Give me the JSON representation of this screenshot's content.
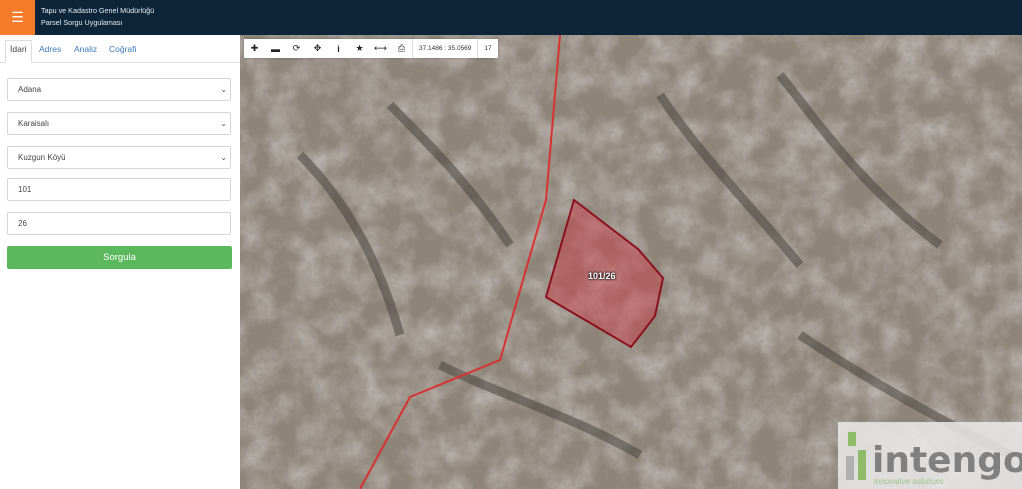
{
  "header": {
    "menu_icon": "menu-icon",
    "title_line1": "Tapu ve Kadastro Genel Müdürlüğü",
    "title_line2": "Parsel Sorgu Uygulaması",
    "bg_color": "#0c2538",
    "menu_color": "#f47b2a"
  },
  "sidebar": {
    "tabs": [
      {
        "label": "İdari",
        "active": true
      },
      {
        "label": "Adres",
        "active": false
      },
      {
        "label": "Analiz",
        "active": false
      },
      {
        "label": "Coğrafi",
        "active": false
      }
    ],
    "il": "Adana",
    "ilce": "Karaisalı",
    "mahalle": "Kuzgun Köyü",
    "ada": "101",
    "parsel": "26",
    "query_button": "Sorgula",
    "button_color": "#5cb85c"
  },
  "map": {
    "toolbar": {
      "icons": [
        "zoom-in-icon",
        "zoom-out-icon",
        "refresh-icon",
        "locate-icon",
        "info-icon",
        "star-icon",
        "measure-icon",
        "print-icon"
      ],
      "coordinates": "37.1486 : 35.0569",
      "zoom": "17"
    },
    "parcel_label": "101/26",
    "parcel_color": "#b0202a",
    "logo": {
      "word": "intengo",
      "tagline": "innovative solutions"
    }
  }
}
